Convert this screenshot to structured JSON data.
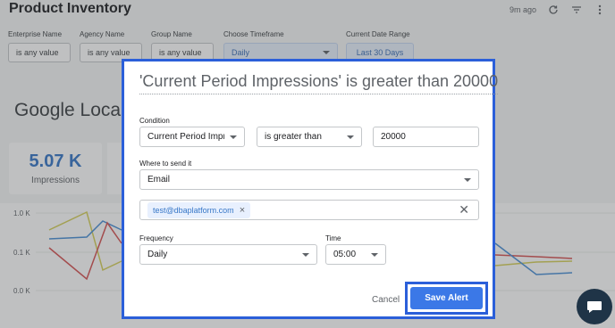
{
  "header": {
    "title": "Product Inventory",
    "updated": "9m ago"
  },
  "filters": [
    {
      "label": "Enterprise Name",
      "value": "is any value"
    },
    {
      "label": "Agency Name",
      "value": "is any value"
    },
    {
      "label": "Group Name",
      "value": "is any value"
    },
    {
      "label": "Choose Timeframe",
      "value": "Daily"
    },
    {
      "label": "Current Date Range",
      "value": "Last 30 Days"
    }
  ],
  "section": {
    "title": "Google Loca"
  },
  "kpi": {
    "value": "5.07 K",
    "label": "Impressions"
  },
  "chart": {
    "y_ticks": [
      "1.0 K",
      "0.1 K",
      "0.0 K"
    ]
  },
  "modal": {
    "title": "'Current Period Impressions' is greater than 20000",
    "condition": {
      "label": "Condition",
      "metric": "Current Period Impr",
      "operator": "is greater than",
      "value": "20000"
    },
    "destination": {
      "label": "Where to send it",
      "channel": "Email",
      "recipients": [
        "test@dbaplatform.com"
      ]
    },
    "frequency": {
      "label": "Frequency",
      "value": "Daily"
    },
    "time": {
      "label": "Time",
      "value": "05:00"
    },
    "cancel_label": "Cancel",
    "save_label": "Save Alert"
  },
  "colors": {
    "accent": "#3b78e7",
    "highlight_frame": "#2b5fd9",
    "kpi_value": "#3777c7",
    "chat": "#1f3447"
  },
  "icons": [
    "refresh-icon",
    "filter-icon",
    "more-vert-icon",
    "close-icon",
    "chat-icon",
    "chevron-down-icon"
  ]
}
